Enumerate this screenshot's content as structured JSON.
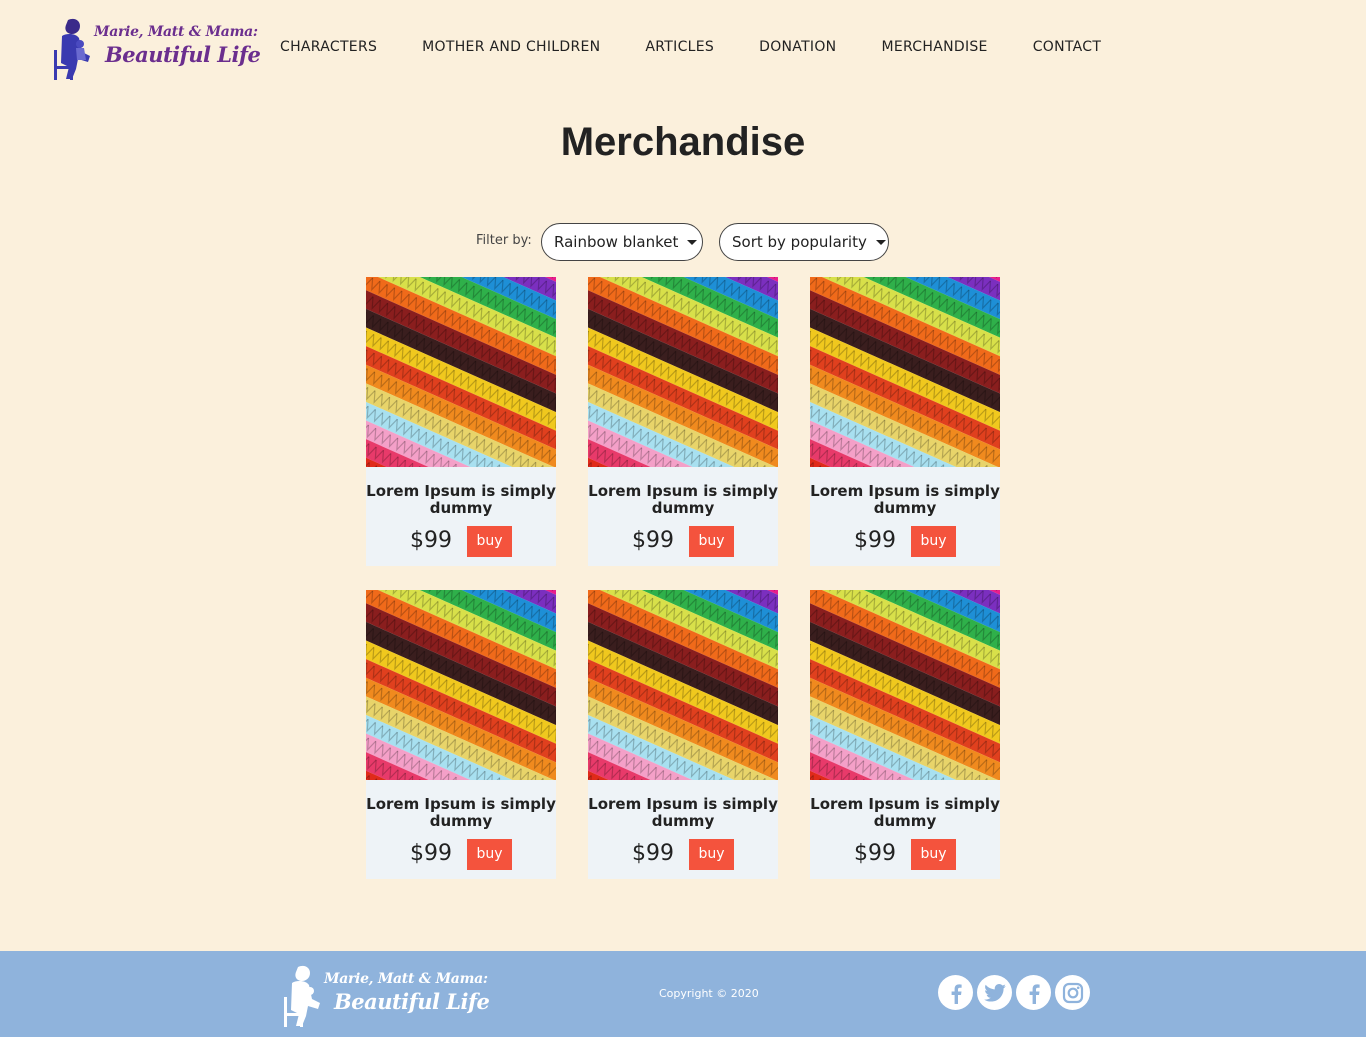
{
  "header": {
    "logo_line1": "Marie, Matt & Mama:",
    "logo_line2": "Beautiful Life",
    "nav": [
      "CHARACTERS",
      "MOTHER AND CHILDREN",
      "ARTICLES",
      "DONATION",
      "MERCHANDISE",
      "CONTACT"
    ]
  },
  "main": {
    "title": "Merchandise",
    "filter_label": "Filter by:",
    "filter_value": "Rainbow blanket",
    "sort_value": "Sort by popularity",
    "products": [
      {
        "name": "Lorem Ipsum is simply dummy",
        "price": "$99",
        "button": "buy"
      },
      {
        "name": "Lorem Ipsum is simply dummy",
        "price": "$99",
        "button": "buy"
      },
      {
        "name": "Lorem Ipsum is simply dummy",
        "price": "$99",
        "button": "buy"
      },
      {
        "name": "Lorem Ipsum is simply dummy",
        "price": "$99",
        "button": "buy"
      },
      {
        "name": "Lorem Ipsum is simply dummy",
        "price": "$99",
        "button": "buy"
      },
      {
        "name": "Lorem Ipsum is simply dummy",
        "price": "$99",
        "button": "buy"
      }
    ]
  },
  "footer": {
    "logo_line1": "Marie, Matt & Mama:",
    "logo_line2": "Beautiful Life",
    "copyright": "Copyright © 2020",
    "socials": [
      "facebook-icon",
      "twitter-icon",
      "facebook-icon",
      "instagram-icon"
    ]
  },
  "colors": {
    "background": "#fbf0dc",
    "footer": "#8fb3dc",
    "buy_button": "#f4533d",
    "card": "#eef3f7",
    "logo_purple": "#6b2e8e"
  }
}
